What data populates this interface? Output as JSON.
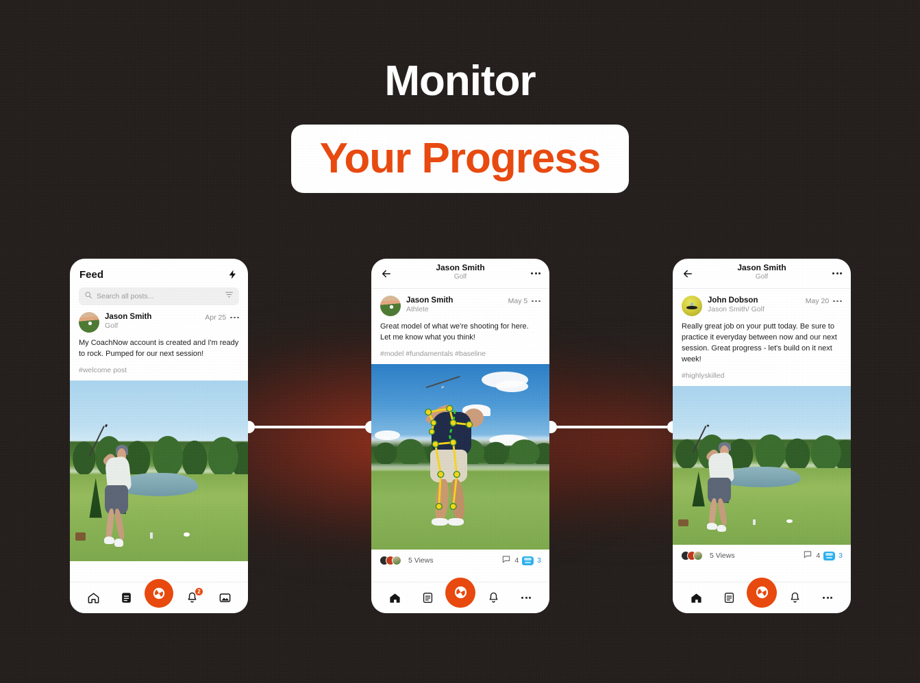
{
  "headline": {
    "line1": "Monitor",
    "line2": "Your Progress",
    "accent_color": "#e8490f",
    "background_color": "#241f1d"
  },
  "phones": [
    {
      "id": "feed",
      "header": {
        "title": "Feed",
        "action_icon": "lightning-bolt-icon"
      },
      "search": {
        "placeholder": "Search all posts...",
        "value": "",
        "leading_icon": "search-icon",
        "trailing_icon": "filter-icon"
      },
      "post": {
        "author": "Jason Smith",
        "role": "Golf",
        "date": "Apr 25",
        "menu_icon": "more-options-icon",
        "body": "My CoachNow account is created and I'm ready to rock. Pumped for our next session!",
        "tags": "#welcome post",
        "media_alt": "golfer-teeing-off-photo"
      },
      "nav": [
        {
          "name": "home",
          "icon": "home-icon",
          "active": false
        },
        {
          "name": "spaces",
          "icon": "document-list-icon",
          "active": false
        },
        {
          "name": "capture",
          "icon": "camera-shutter-icon",
          "fab": true
        },
        {
          "name": "notifications",
          "icon": "bell-icon",
          "badge": "2"
        },
        {
          "name": "media",
          "icon": "photo-icon",
          "active": false
        }
      ]
    },
    {
      "id": "post-detail-model",
      "header": {
        "back_icon": "back-arrow-icon",
        "title": "Jason Smith",
        "subtitle": "Golf",
        "menu_icon": "more-options-icon"
      },
      "post": {
        "author": "Jason Smith",
        "role": "Athlete",
        "date": "May 5",
        "menu_icon": "more-options-icon",
        "body": "Great model of what we're shooting for here. Let me know what you think!",
        "tags": "#model #fundamentals #baseline",
        "media_alt": "golf-swing-with-pose-overlay-photo"
      },
      "engagement": {
        "views": "5 Views",
        "comment_icon": "comment-icon",
        "comments": "4",
        "reaction_icon": "fist-bump-icon",
        "reactions": "3"
      },
      "nav": [
        {
          "name": "home",
          "icon": "home-icon",
          "active": true
        },
        {
          "name": "spaces",
          "icon": "document-list-icon",
          "active": false
        },
        {
          "name": "capture",
          "icon": "camera-shutter-icon",
          "fab": true
        },
        {
          "name": "notifications",
          "icon": "bell-icon",
          "active": false
        },
        {
          "name": "more",
          "icon": "ellipsis-icon",
          "active": false
        }
      ]
    },
    {
      "id": "post-detail-feedback",
      "header": {
        "back_icon": "back-arrow-icon",
        "title": "Jason Smith",
        "subtitle": "Golf",
        "menu_icon": "more-options-icon"
      },
      "post": {
        "author": "John Dobson",
        "role": "Jason Smith/ Golf",
        "date": "May 20",
        "menu_icon": "more-options-icon",
        "body": "Really great job on your putt today. Be sure to practice it everyday between now and our next session. Great progress - let's build on it next week!",
        "tags": "#highlyskilled",
        "media_alt": "golfer-teeing-off-photo"
      },
      "engagement": {
        "views": "5 Views",
        "comment_icon": "comment-icon",
        "comments": "4",
        "reaction_icon": "fist-bump-icon",
        "reactions": "3"
      },
      "nav": [
        {
          "name": "home",
          "icon": "home-icon",
          "active": true
        },
        {
          "name": "spaces",
          "icon": "document-list-icon",
          "active": false
        },
        {
          "name": "capture",
          "icon": "camera-shutter-icon",
          "fab": true
        },
        {
          "name": "notifications",
          "icon": "bell-icon",
          "active": false
        },
        {
          "name": "more",
          "icon": "ellipsis-icon",
          "active": false
        }
      ]
    }
  ]
}
